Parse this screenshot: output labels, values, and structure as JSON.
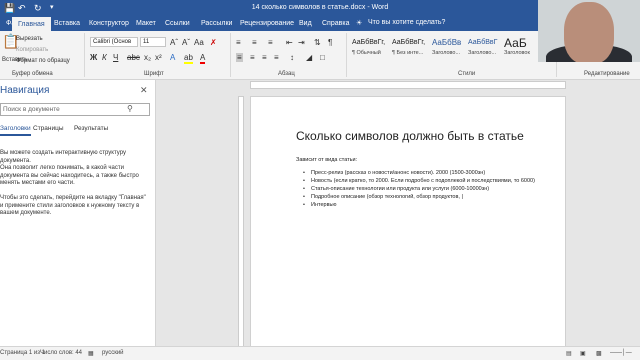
{
  "window": {
    "title": "14 сколько символов в статье.docx - Word",
    "qa_icons": [
      "save-icon",
      "undo-icon",
      "redo-icon"
    ]
  },
  "tabs": [
    {
      "label": "Файл"
    },
    {
      "label": "Главная",
      "active": true
    },
    {
      "label": "Вставка"
    },
    {
      "label": "Конструктор"
    },
    {
      "label": "Макет"
    },
    {
      "label": "Ссылки"
    },
    {
      "label": "Рассылки"
    },
    {
      "label": "Рецензирование"
    },
    {
      "label": "Вид"
    },
    {
      "label": "Справка"
    }
  ],
  "tell_me": "Что вы хотите сделать?",
  "ribbon": {
    "clipboard": {
      "paste": "Вставить",
      "cut": "Вырезать",
      "copy": "Копировать",
      "format_painter": "Формат по образцу",
      "label": "Буфер обмена"
    },
    "font": {
      "name": "Calibri (Основ",
      "size": "11",
      "label": "Шрифт"
    },
    "paragraph": {
      "label": "Абзац"
    },
    "styles": {
      "label": "Стили",
      "items": [
        {
          "sample": "АаБбВвГг,",
          "name": "¶ Обычный"
        },
        {
          "sample": "АаБбВвГг,",
          "name": "¶ Без инте..."
        },
        {
          "sample": "АаБбВв",
          "name": "Заголово..."
        },
        {
          "sample": "АаБбВвГ",
          "name": "Заголово..."
        },
        {
          "sample": "АаБ",
          "name": "Заголовок"
        }
      ]
    },
    "editing": {
      "label": "Редактирование"
    }
  },
  "nav": {
    "title": "Навигация",
    "search_placeholder": "Поиск в документе",
    "tabs": [
      "Заголовки",
      "Страницы",
      "Результаты"
    ],
    "paragraphs": [
      "Вы можете создать интерактивную структуру документа.",
      "Она позволит легко понимать, в какой части документа вы сейчас находитесь, а также быстро менять местами его части.",
      "Чтобы это сделать, перейдите на вкладку \"Главная\" и примените стили заголовков к нужному тексту в вашем документе."
    ]
  },
  "document": {
    "heading": "Сколько символов должно быть в статье",
    "intro": "Зависит от вида статьи:",
    "bullets": [
      "Пресс-релиз (рассказ о новости/анонс новости). 2000 (1500-3000зн)",
      "Новость (если кратко, то 2000. Если подробно с подоплекой и последствиями, то 6000)",
      "Статья-описание технологии или продукта или услуги (6000-10000зн)",
      "Подробное описание (обзор технологий, обзор продуктов, |",
      "Интервью"
    ]
  },
  "status": {
    "page": "Страница 1 из 1",
    "words": "Число слов: 44",
    "language": "русский"
  },
  "colors": {
    "accent": "#2b579a"
  }
}
